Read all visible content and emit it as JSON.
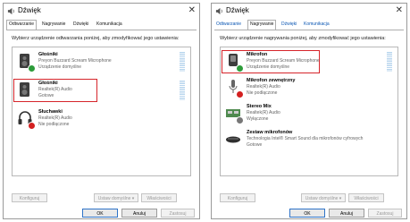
{
  "left": {
    "title": "Dźwięk",
    "tabs": [
      "Odtwarzanie",
      "Nagrywanie",
      "Dźwięki",
      "Komunikacja"
    ],
    "instruction": "Wybierz urządzenie odtwarzania poniżej, aby zmodyfikować jego ustawienia:",
    "devices": [
      {
        "name": "Głośniki",
        "line2": "Preyon Buzzard Scream Microphone",
        "line3": "Urządzenie domyślne"
      },
      {
        "name": "Głośniki",
        "line2": "Realtek(R) Audio",
        "line3": "Gotowe"
      },
      {
        "name": "Słuchawki",
        "line2": "Realtek(R) Audio",
        "line3": "Nie podłączone"
      }
    ],
    "buttons": {
      "configure": "Konfiguruj",
      "set_default": "Ustaw domyślne",
      "properties": "Właściwości",
      "ok": "OK",
      "cancel": "Anuluj",
      "apply": "Zastosuj"
    }
  },
  "right": {
    "title": "Dźwięk",
    "tabs": [
      "Odtwarzanie",
      "Nagrywanie",
      "Dźwięki",
      "Komunikacja"
    ],
    "instruction": "Wybierz urządzenie nagrywania poniżej, aby zmodyfikować jego ustawienia:",
    "devices": [
      {
        "name": "Mikrofon",
        "line2": "Preyon Buzzard Scream Microphone",
        "line3": "Urządzenie domyślne"
      },
      {
        "name": "Mikrofon zewnętrzny",
        "line2": "Realtek(R) Audio",
        "line3": "Nie podłączone"
      },
      {
        "name": "Stereo Mix",
        "line2": "Realtek(R) Audio",
        "line3": "Wyłączone"
      },
      {
        "name": "Zestaw mikrofonów",
        "line2": "Technologia Intel® Smart Sound dla mikrofonów cyfrowych",
        "line3": "Gotowe"
      }
    ],
    "buttons": {
      "configure": "Konfiguruj",
      "set_default": "Ustaw domyślne",
      "properties": "Właściwości",
      "ok": "OK",
      "cancel": "Anuluj",
      "apply": "Zastosuj"
    }
  },
  "colors": {
    "highlight": "#d6252b",
    "accent": "#0a56b3",
    "check_badge": "#2d9c3a",
    "no_badge": "#d32020"
  }
}
